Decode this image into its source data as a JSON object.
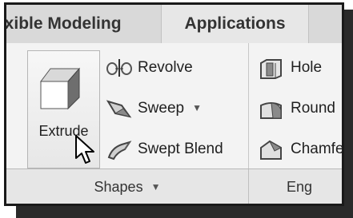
{
  "tabs": {
    "flexible_modeling": "exible Modeling",
    "applications": "Applications"
  },
  "shapes_group": {
    "extrude": "Extrude",
    "revolve": "Revolve",
    "sweep": "Sweep",
    "swept_blend": "Swept Blend",
    "group_label": "Shapes",
    "dropdown_caret": "▼"
  },
  "engineering_group": {
    "hole": "Hole",
    "round": "Round",
    "chamfer": "Chamfe",
    "group_label": "Eng"
  }
}
